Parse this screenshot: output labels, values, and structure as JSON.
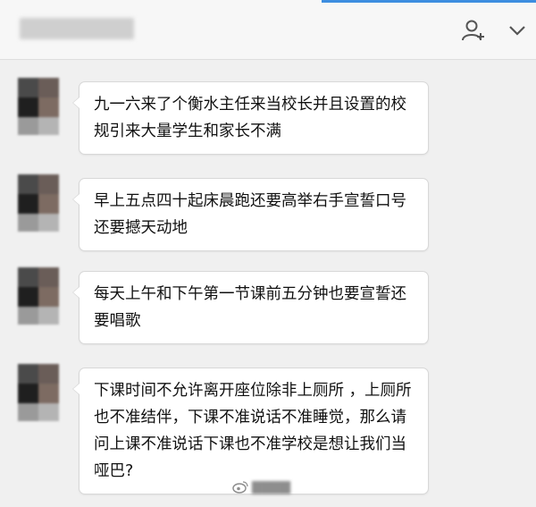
{
  "header": {
    "add_member_icon": "add-user-icon",
    "expand_icon": "chevron-down-icon"
  },
  "colors": {
    "accent_line": "#3d8ee0",
    "bubble_bg": "#ffffff",
    "chat_bg": "#f0f0f0"
  },
  "messages": [
    {
      "text": "九一六来了个衡水主任来当校长并且设置的校规引来大量学生和家长不满"
    },
    {
      "text": "早上五点四十起床晨跑还要高举右手宣誓口号还要撼天动地"
    },
    {
      "text": "每天上午和下午第一节课前五分钟也要宣誓还要唱歌"
    },
    {
      "text": "下课时间不允许离开座位除非上厕所 ，上厕所也不准结伴，下课不准说话不准睡觉，那么请问上课不准说话下课也不准学校是想让我们当哑巴?"
    }
  ],
  "watermark": {
    "icon": "weibo-icon"
  }
}
